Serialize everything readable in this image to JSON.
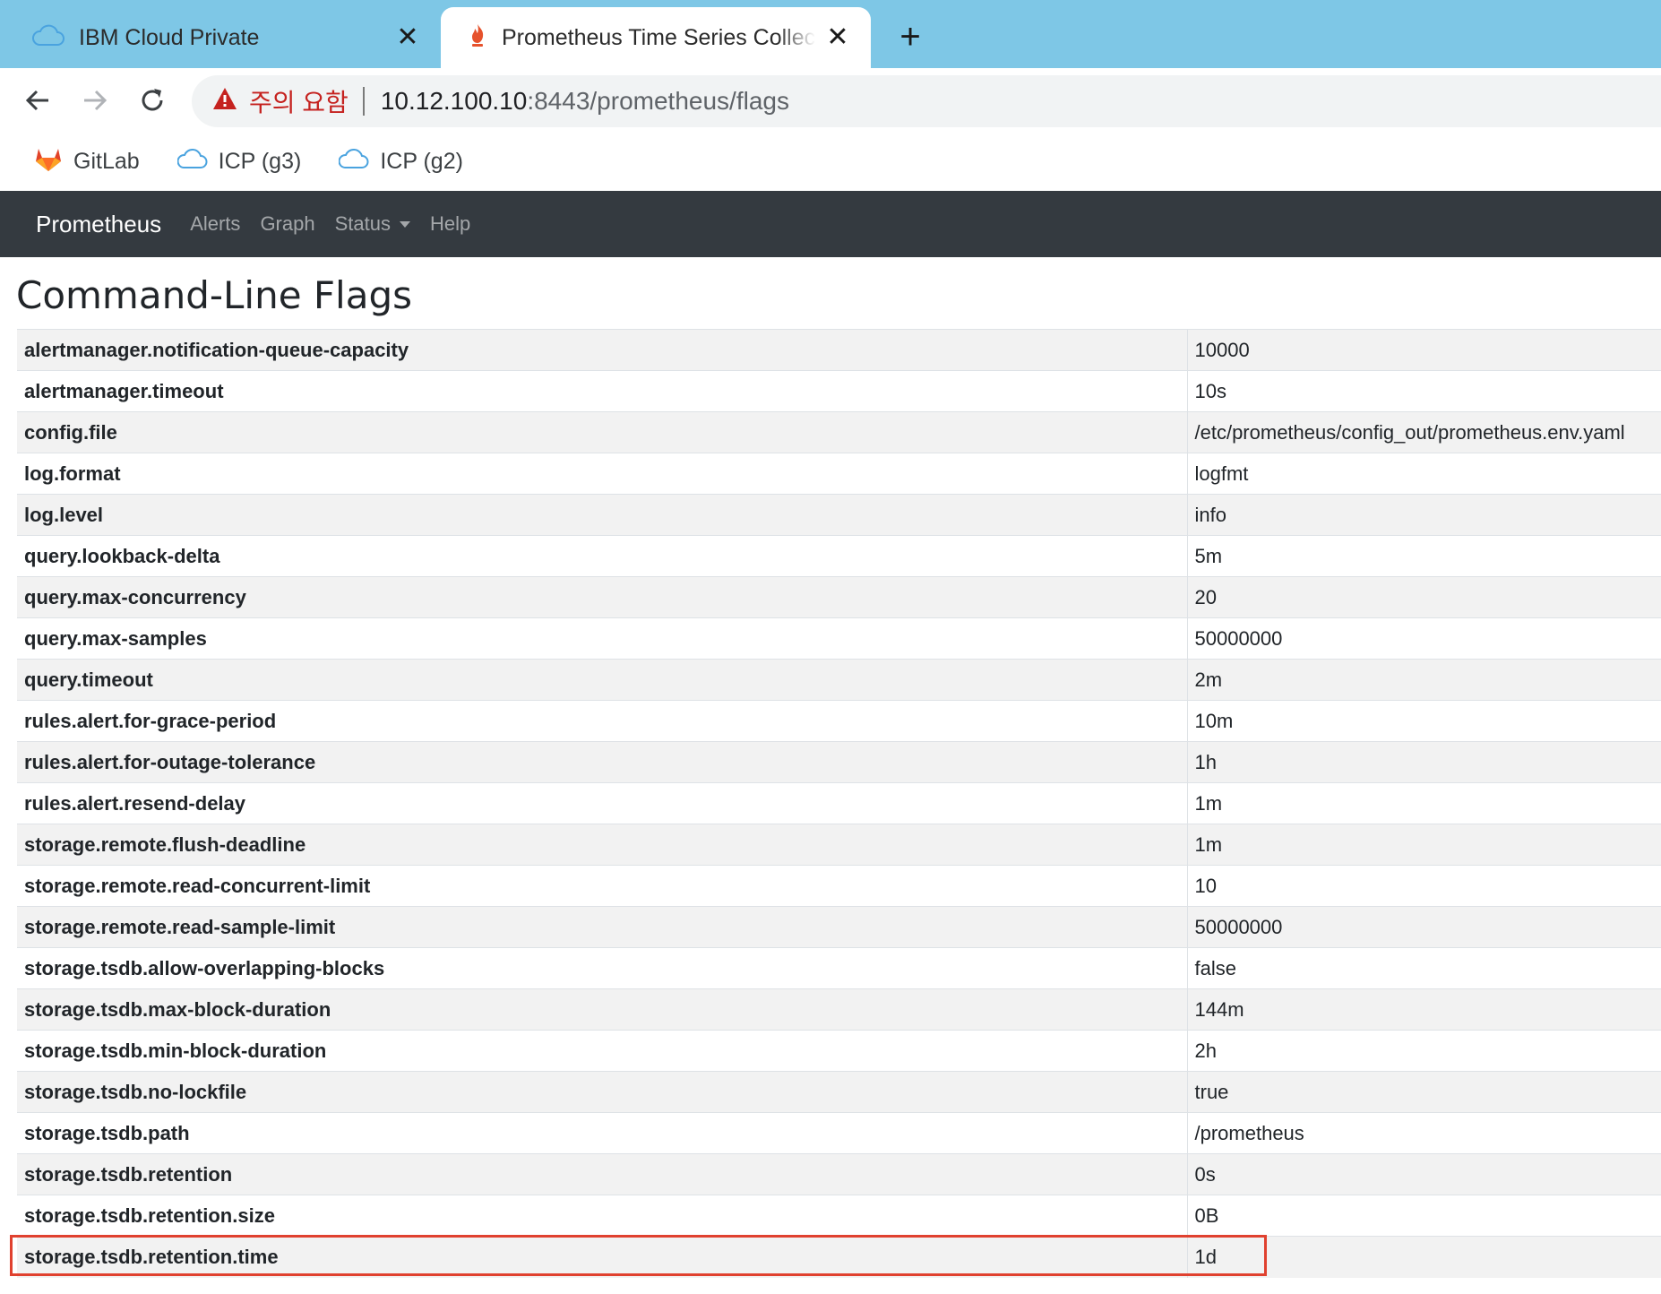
{
  "browser": {
    "tabs": [
      {
        "title": "IBM Cloud Private",
        "icon": "cloud-icon"
      },
      {
        "title": "Prometheus Time Series Collectio",
        "icon": "prometheus-flame-icon"
      }
    ],
    "security_warning": "주의 요함",
    "url_host": "10.12.100.10",
    "url_rest": ":8443/prometheus/flags",
    "bookmarks": [
      {
        "label": "GitLab",
        "icon": "gitlab-icon"
      },
      {
        "label": "ICP (g3)",
        "icon": "cloud-icon"
      },
      {
        "label": "ICP (g2)",
        "icon": "cloud-icon"
      }
    ]
  },
  "navbar": {
    "brand": "Prometheus",
    "links": [
      "Alerts",
      "Graph",
      "Status",
      "Help"
    ]
  },
  "page": {
    "title": "Command-Line Flags"
  },
  "flags": [
    {
      "name": "alertmanager.notification-queue-capacity",
      "value": "10000"
    },
    {
      "name": "alertmanager.timeout",
      "value": "10s"
    },
    {
      "name": "config.file",
      "value": "/etc/prometheus/config_out/prometheus.env.yaml"
    },
    {
      "name": "log.format",
      "value": "logfmt"
    },
    {
      "name": "log.level",
      "value": "info"
    },
    {
      "name": "query.lookback-delta",
      "value": "5m"
    },
    {
      "name": "query.max-concurrency",
      "value": "20"
    },
    {
      "name": "query.max-samples",
      "value": "50000000"
    },
    {
      "name": "query.timeout",
      "value": "2m"
    },
    {
      "name": "rules.alert.for-grace-period",
      "value": "10m"
    },
    {
      "name": "rules.alert.for-outage-tolerance",
      "value": "1h"
    },
    {
      "name": "rules.alert.resend-delay",
      "value": "1m"
    },
    {
      "name": "storage.remote.flush-deadline",
      "value": "1m"
    },
    {
      "name": "storage.remote.read-concurrent-limit",
      "value": "10"
    },
    {
      "name": "storage.remote.read-sample-limit",
      "value": "50000000"
    },
    {
      "name": "storage.tsdb.allow-overlapping-blocks",
      "value": "false"
    },
    {
      "name": "storage.tsdb.max-block-duration",
      "value": "144m"
    },
    {
      "name": "storage.tsdb.min-block-duration",
      "value": "2h"
    },
    {
      "name": "storage.tsdb.no-lockfile",
      "value": "true"
    },
    {
      "name": "storage.tsdb.path",
      "value": "/prometheus"
    },
    {
      "name": "storage.tsdb.retention",
      "value": "0s"
    },
    {
      "name": "storage.tsdb.retention.size",
      "value": "0B"
    },
    {
      "name": "storage.tsdb.retention.time",
      "value": "1d"
    }
  ],
  "highlight_color": "#e0412f"
}
